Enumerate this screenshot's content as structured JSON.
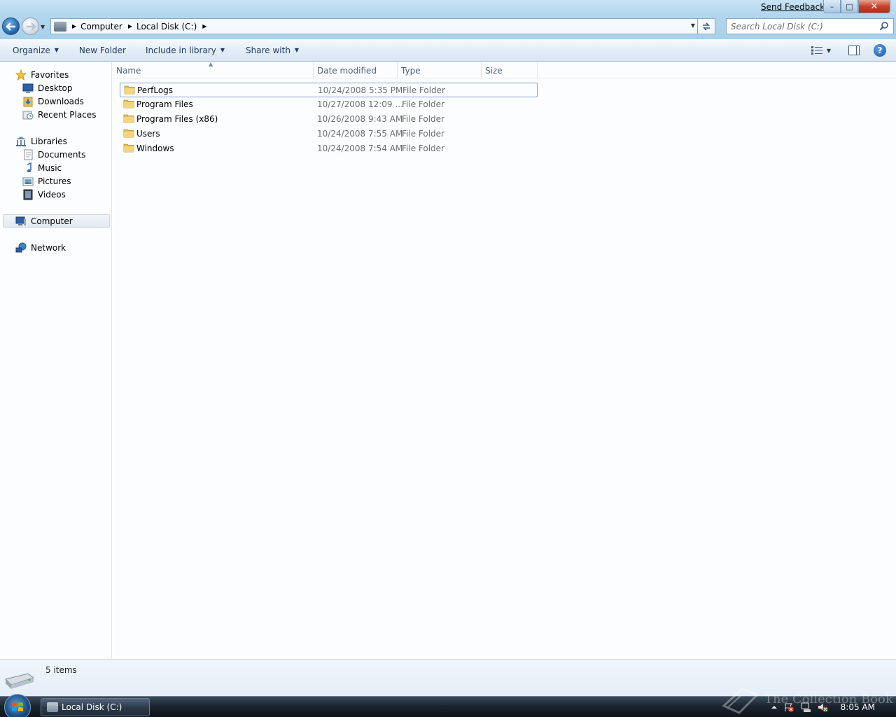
{
  "window": {
    "feedback_link": "Send Feedback",
    "minimize_glyph": "–",
    "maximize_glyph": "□",
    "close_glyph": "✕"
  },
  "address": {
    "segments": [
      "Computer",
      "Local Disk (C:)"
    ],
    "search_placeholder": "Search Local Disk (C:)"
  },
  "commandbar": {
    "organize": "Organize",
    "new_folder": "New Folder",
    "include_in_library": "Include in library",
    "share_with": "Share with"
  },
  "navpane": {
    "favorites": {
      "label": "Favorites",
      "items": [
        "Desktop",
        "Downloads",
        "Recent Places"
      ]
    },
    "libraries": {
      "label": "Libraries",
      "items": [
        "Documents",
        "Music",
        "Pictures",
        "Videos"
      ]
    },
    "computer": "Computer",
    "network": "Network"
  },
  "columns": {
    "name": "Name",
    "date": "Date modified",
    "type": "Type",
    "size": "Size"
  },
  "files": [
    {
      "name": "PerfLogs",
      "date": "10/24/2008 5:35 PM",
      "type": "File Folder"
    },
    {
      "name": "Program Files",
      "date": "10/27/2008 12:09 ...",
      "type": "File Folder"
    },
    {
      "name": "Program Files (x86)",
      "date": "10/26/2008 9:43 AM",
      "type": "File Folder"
    },
    {
      "name": "Users",
      "date": "10/24/2008 7:55 AM",
      "type": "File Folder"
    },
    {
      "name": "Windows",
      "date": "10/24/2008 7:54 AM",
      "type": "File Folder"
    }
  ],
  "details": {
    "item_count": "5 items"
  },
  "taskbar": {
    "open_window": "Local Disk (C:)",
    "clock": "8:05 AM"
  },
  "watermark": "The Collection Book",
  "colors": {
    "title_gradient": "#b2d6ef",
    "command_text": "#1e395b",
    "folder_yellow": "#e8c05a",
    "close_red": "#c7432a",
    "taskbar_dark": "#1c2530"
  }
}
